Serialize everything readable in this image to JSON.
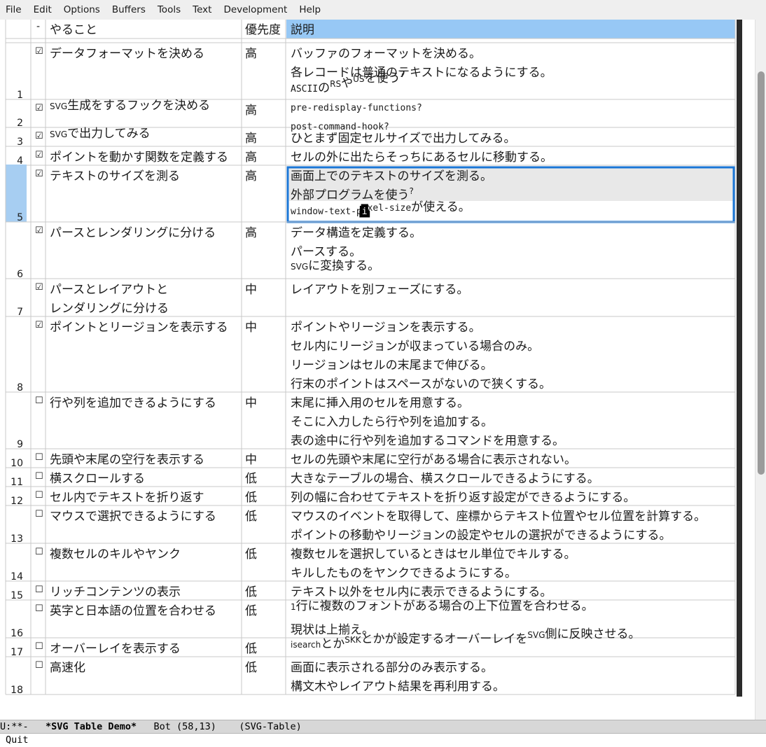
{
  "menubar": {
    "items": [
      "File",
      "Edit",
      "Options",
      "Buffers",
      "Tools",
      "Text",
      "Development",
      "Help"
    ]
  },
  "table": {
    "header": {
      "mark": "-",
      "task": "やること",
      "priority": "優先度",
      "desc": "説明"
    },
    "rows": [
      {
        "num": "1",
        "done": true,
        "task": [
          "データフォーマットを決める"
        ],
        "priority": "高",
        "desc": [
          [
            {
              "t": "バッファのフォーマットを決める。"
            }
          ],
          [
            {
              "t": "各レコードは普通のテキストになるようにする。"
            }
          ],
          [
            {
              "t": "ASCII",
              "s": "mono-small"
            },
            {
              "t": "の"
            },
            {
              "t": "RS",
              "s": "sup"
            },
            {
              "t": "や"
            },
            {
              "t": "US",
              "s": "sup"
            },
            {
              "t": "を使う"
            },
            {
              "t": "?",
              "s": "sup"
            }
          ]
        ]
      },
      {
        "num": "2",
        "done": true,
        "task": [
          [
            {
              "t": "SVG",
              "s": "sup"
            },
            {
              "t": "生成をするフックを決める"
            }
          ]
        ],
        "priority": "高",
        "desc": [
          [
            {
              "t": "pre-redisplay-functions?",
              "s": "mono-small"
            }
          ],
          [
            {
              "t": "post-command-hook?",
              "s": "mono-small"
            }
          ]
        ]
      },
      {
        "num": "3",
        "done": true,
        "task": [
          [
            {
              "t": "SVG",
              "s": "sup"
            },
            {
              "t": "で出力してみる"
            }
          ]
        ],
        "priority": "高",
        "desc": [
          [
            {
              "t": "ひとまず固定セルサイズで出力してみる。"
            }
          ]
        ]
      },
      {
        "num": "4",
        "done": true,
        "task": [
          "ポイントを動かす関数を定義する"
        ],
        "priority": "高",
        "desc": [
          [
            {
              "t": "セルの外に出たらそっちにあるセルに移動する。"
            }
          ]
        ]
      },
      {
        "num": "5",
        "done": true,
        "task": [
          "テキストのサイズを測る"
        ],
        "priority": "高",
        "desc": [
          [
            {
              "t": "画面上でのテキストのサイズを測る。"
            }
          ],
          [
            {
              "t": "外部プログラムを使う"
            },
            {
              "t": "?",
              "s": "sup"
            }
          ],
          [
            {
              "t": "window-text-p",
              "s": "mono-small"
            },
            {
              "t": "i",
              "s": "cursor"
            },
            {
              "t": "xel-size",
              "s": "mono-small"
            },
            {
              "t": "が使える。"
            }
          ]
        ]
      },
      {
        "num": "6",
        "done": true,
        "task": [
          "パースとレンダリングに分ける"
        ],
        "priority": "高",
        "desc": [
          [
            {
              "t": "データ構造を定義する。"
            }
          ],
          [
            {
              "t": "パースする。"
            }
          ],
          [
            {
              "t": "SVG",
              "s": "sup"
            },
            {
              "t": "に変換する。"
            }
          ]
        ]
      },
      {
        "num": "7",
        "done": true,
        "task": [
          "パースとレイアウトと",
          "レンダリングに分ける"
        ],
        "priority": "中",
        "desc": [
          [
            {
              "t": "レイアウトを別フェーズにする。"
            }
          ]
        ]
      },
      {
        "num": "8",
        "done": true,
        "task": [
          "ポイントとリージョンを表示する"
        ],
        "priority": "中",
        "desc": [
          [
            {
              "t": "ポイントやリージョンを表示する。"
            }
          ],
          [
            {
              "t": "セル内にリージョンが収まっている場合のみ。"
            }
          ],
          [
            {
              "t": "リージョンはセルの末尾まで伸びる。"
            }
          ],
          [
            {
              "t": "行末のポイントはスペースがないので狭くする。"
            }
          ]
        ]
      },
      {
        "num": "9",
        "done": false,
        "task": [
          "行や列を追加できるようにする"
        ],
        "priority": "中",
        "desc": [
          [
            {
              "t": "末尾に挿入用のセルを用意する。"
            }
          ],
          [
            {
              "t": "そこに入力したら行や列を追加する。"
            }
          ],
          [
            {
              "t": "表の途中に行や列を追加するコマンドを用意する。"
            }
          ]
        ]
      },
      {
        "num": "10",
        "done": false,
        "task": [
          "先頭や末尾の空行を表示する"
        ],
        "priority": "中",
        "desc": [
          [
            {
              "t": "セルの先頭や末尾に空行がある場合に表示されない。"
            }
          ]
        ]
      },
      {
        "num": "11",
        "done": false,
        "task": [
          "横スクロールする"
        ],
        "priority": "低",
        "desc": [
          [
            {
              "t": "大きなテーブルの場合、横スクロールできるようにする。"
            }
          ]
        ]
      },
      {
        "num": "12",
        "done": false,
        "task": [
          "セル内でテキストを折り返す"
        ],
        "priority": "低",
        "desc": [
          [
            {
              "t": "列の幅に合わせてテキストを折り返す設定ができるようにする。"
            }
          ]
        ]
      },
      {
        "num": "13",
        "done": false,
        "task": [
          "マウスで選択できるようにする"
        ],
        "priority": "低",
        "desc": [
          [
            {
              "t": "マウスのイベントを取得して、座標からテキスト位置やセル位置を計算する。"
            }
          ],
          [
            {
              "t": "ポイントの移動やリージョンの設定やセルの選択ができるようにする。"
            }
          ]
        ]
      },
      {
        "num": "14",
        "done": false,
        "task": [
          "複数セルのキルやヤンク"
        ],
        "priority": "低",
        "desc": [
          [
            {
              "t": "複数セルを選択しているときはセル単位でキルする。"
            }
          ],
          [
            {
              "t": "キルしたものをヤンクできるようにする。"
            }
          ]
        ]
      },
      {
        "num": "15",
        "done": false,
        "task": [
          "リッチコンテンツの表示"
        ],
        "priority": "低",
        "desc": [
          [
            {
              "t": "テキスト以外をセル内に表示できるようにする。"
            }
          ]
        ]
      },
      {
        "num": "16",
        "done": false,
        "task": [
          "英字と日本語の位置を合わせる"
        ],
        "priority": "低",
        "desc": [
          [
            {
              "t": "1",
              "s": "sup"
            },
            {
              "t": "行に複数のフォントがある場合の上下位置を合わせる。"
            }
          ],
          [
            {
              "t": "現状は上揃え。"
            }
          ]
        ]
      },
      {
        "num": "17",
        "done": false,
        "task": [
          "オーバーレイを表示する"
        ],
        "priority": "低",
        "desc": [
          [
            {
              "t": "isearch",
              "s": "sup"
            },
            {
              "t": "とか"
            },
            {
              "t": "SKK",
              "s": "sup"
            },
            {
              "t": "とかが設定するオーバーレイを"
            },
            {
              "t": "SVG",
              "s": "sup"
            },
            {
              "t": "側に反映させる。"
            }
          ]
        ]
      },
      {
        "num": "18",
        "done": false,
        "task": [
          "高速化"
        ],
        "priority": "低",
        "desc": [
          [
            {
              "t": "画面に表示される部分のみ表示する。"
            }
          ],
          [
            {
              "t": "構文木やレイアウト結果を再利用する。"
            }
          ]
        ]
      }
    ],
    "current_row": "5",
    "checkbox_checked": "☑",
    "checkbox_unchecked": "☐",
    "colors": {
      "header_highlight": "#97c8f5",
      "row_highlight": "#a7cef2",
      "selected_border": "#1a76d6",
      "region": "#e8e8e8",
      "grid": "#c8c8c8"
    }
  },
  "modeline": {
    "status": "U:**-",
    "buffer_name": "*SVG Table Demo*",
    "position": "Bot (58,13)",
    "mode": "(SVG-Table)"
  },
  "minibuffer": {
    "message": "Quit"
  }
}
